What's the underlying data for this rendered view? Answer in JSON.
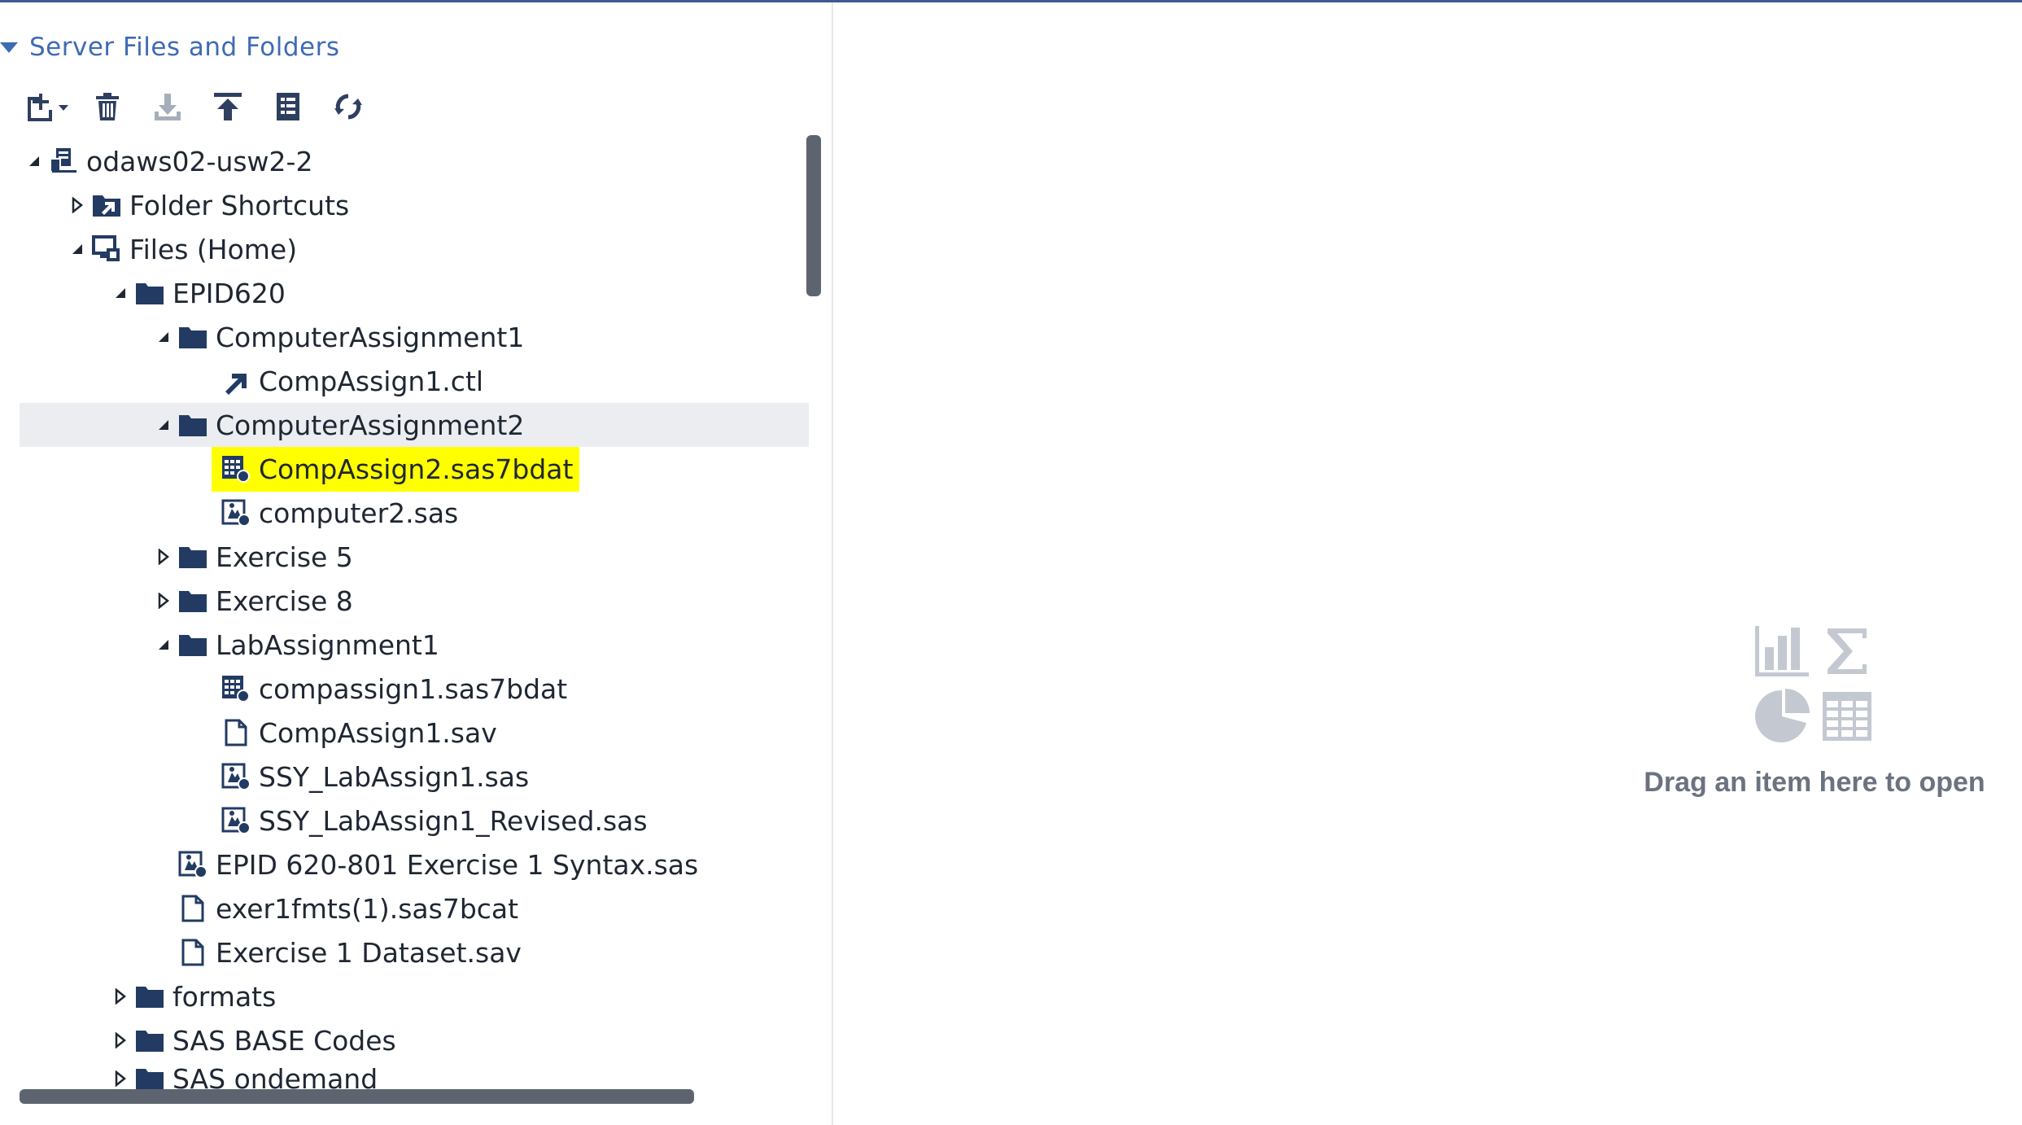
{
  "panel": {
    "title": "Server Files and Folders"
  },
  "toolbar": {
    "buttons": [
      {
        "icon": "new-file-icon"
      },
      {
        "icon": "delete-icon"
      },
      {
        "icon": "download-icon"
      },
      {
        "icon": "upload-icon"
      },
      {
        "icon": "properties-icon"
      },
      {
        "icon": "refresh-icon"
      }
    ]
  },
  "tree": [
    {
      "label": "odaws02-usw2-2",
      "icon": "server-icon",
      "level": 0,
      "state": "expanded"
    },
    {
      "label": "Folder Shortcuts",
      "icon": "folder-shortcuts-icon",
      "level": 1,
      "state": "collapsed"
    },
    {
      "label": "Files (Home)",
      "icon": "home-files-icon",
      "level": 1,
      "state": "expanded"
    },
    {
      "label": "EPID620",
      "icon": "folder-icon",
      "level": 2,
      "state": "expanded"
    },
    {
      "label": "ComputerAssignment1",
      "icon": "folder-icon",
      "level": 3,
      "state": "expanded"
    },
    {
      "label": "CompAssign1.ctl",
      "icon": "shortcut-file-icon",
      "level": 4,
      "state": "leaf"
    },
    {
      "label": "ComputerAssignment2",
      "icon": "folder-icon",
      "level": 3,
      "state": "expanded",
      "selected": true
    },
    {
      "label": "CompAssign2.sas7bdat",
      "icon": "dataset-icon",
      "level": 4,
      "state": "leaf",
      "highlighted": true
    },
    {
      "label": "computer2.sas",
      "icon": "sas-program-icon",
      "level": 4,
      "state": "leaf"
    },
    {
      "label": "Exercise 5",
      "icon": "folder-icon",
      "level": 3,
      "state": "collapsed"
    },
    {
      "label": "Exercise 8",
      "icon": "folder-icon",
      "level": 3,
      "state": "collapsed"
    },
    {
      "label": "LabAssignment1",
      "icon": "folder-icon",
      "level": 3,
      "state": "expanded"
    },
    {
      "label": "compassign1.sas7bdat",
      "icon": "dataset-icon",
      "level": 4,
      "state": "leaf"
    },
    {
      "label": "CompAssign1.sav",
      "icon": "file-icon",
      "level": 4,
      "state": "leaf"
    },
    {
      "label": "SSY_LabAssign1.sas",
      "icon": "sas-program-icon",
      "level": 4,
      "state": "leaf"
    },
    {
      "label": "SSY_LabAssign1_Revised.sas",
      "icon": "sas-program-icon",
      "level": 4,
      "state": "leaf"
    },
    {
      "label": "EPID 620-801 Exercise 1 Syntax.sas",
      "icon": "sas-program-icon",
      "level": 3,
      "state": "leaf"
    },
    {
      "label": "exer1fmts(1).sas7bcat",
      "icon": "file-icon",
      "level": 3,
      "state": "leaf"
    },
    {
      "label": "Exercise 1 Dataset.sav",
      "icon": "file-icon",
      "level": 3,
      "state": "leaf"
    },
    {
      "label": "formats",
      "icon": "folder-icon",
      "level": 2,
      "state": "collapsed"
    },
    {
      "label": "SAS BASE Codes",
      "icon": "folder-icon",
      "level": 2,
      "state": "collapsed"
    },
    {
      "label": "SAS ondemand",
      "icon": "folder-icon",
      "level": 2,
      "state": "collapsed"
    }
  ],
  "placeholder": {
    "text": "Drag an item here to open",
    "icons": [
      "bar-chart-icon",
      "sigma-icon",
      "pie-chart-icon",
      "table-icon"
    ]
  },
  "colors": {
    "accent": "#3f6bb3",
    "icon": "#2f3f5f",
    "highlight": "#ffff00",
    "selected_row": "#ebedf0"
  }
}
